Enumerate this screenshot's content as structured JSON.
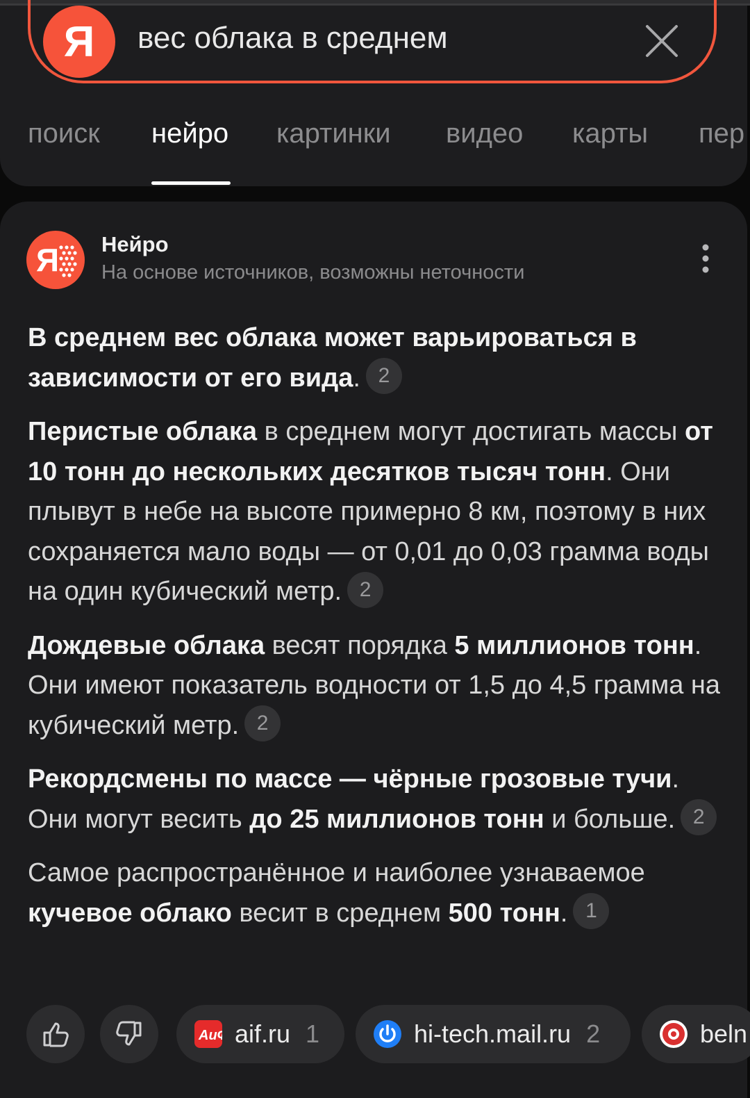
{
  "search": {
    "logo_letter": "Я",
    "query": "вес облака в среднем"
  },
  "tabs": [
    {
      "label": "поиск",
      "active": false
    },
    {
      "label": "нейро",
      "active": true
    },
    {
      "label": "картинки",
      "active": false
    },
    {
      "label": "видео",
      "active": false
    },
    {
      "label": "карты",
      "active": false
    },
    {
      "label": "пер",
      "active": false
    }
  ],
  "neuro": {
    "title": "Нейро",
    "subtitle": "На основе источников, возможны неточности"
  },
  "answer": {
    "p1": {
      "bold": "В среднем вес облака может варьироваться в зависимости от его вида",
      "end": ".",
      "ref": "2"
    },
    "p2": {
      "b1": "Перистые облака",
      "t1": " в среднем могут достигать массы ",
      "b2": "от 10 тонн до нескольких десятков тысяч тонн",
      "t2": ". Они плывут в небе на высоте примерно 8 км, поэтому в них сохраняется мало воды — от 0,01 до 0,03 грамма воды на один кубический метр.",
      "ref": "2"
    },
    "p3": {
      "b1": "Дождевые облака",
      "t1": " весят порядка ",
      "b2": "5 миллионов тонн",
      "t2": ". Они имеют показатель водности от 1,5 до 4,5 грамма на кубический метр.",
      "ref": "2"
    },
    "p4": {
      "b1": "Рекордсмены по массе — чёрные грозовые тучи",
      "t1": ". Они могут весить ",
      "b2": "до 25 миллионов тонн",
      "t2": " и больше.",
      "ref": "2"
    },
    "p5": {
      "t1": "Самое распространённое и наиболее узнаваемое ",
      "b1": "кучевое облако",
      "t2": " весит в среднем ",
      "b2": "500 тонн",
      "t3": ".",
      "ref": "1"
    }
  },
  "sources": [
    {
      "name": "aif.ru",
      "count": "1",
      "icon": "aif-icon",
      "color": "#e52b2b"
    },
    {
      "name": "hi-tech.mail.ru",
      "count": "2",
      "icon": "power-icon",
      "color": "#1f7ef6"
    },
    {
      "name": "beln",
      "count": "",
      "icon": "beln-icon",
      "color": "#d93030"
    }
  ],
  "colors": {
    "accent": "#f6533a",
    "background": "#0a0a0a",
    "card": "#1c1c1e"
  }
}
